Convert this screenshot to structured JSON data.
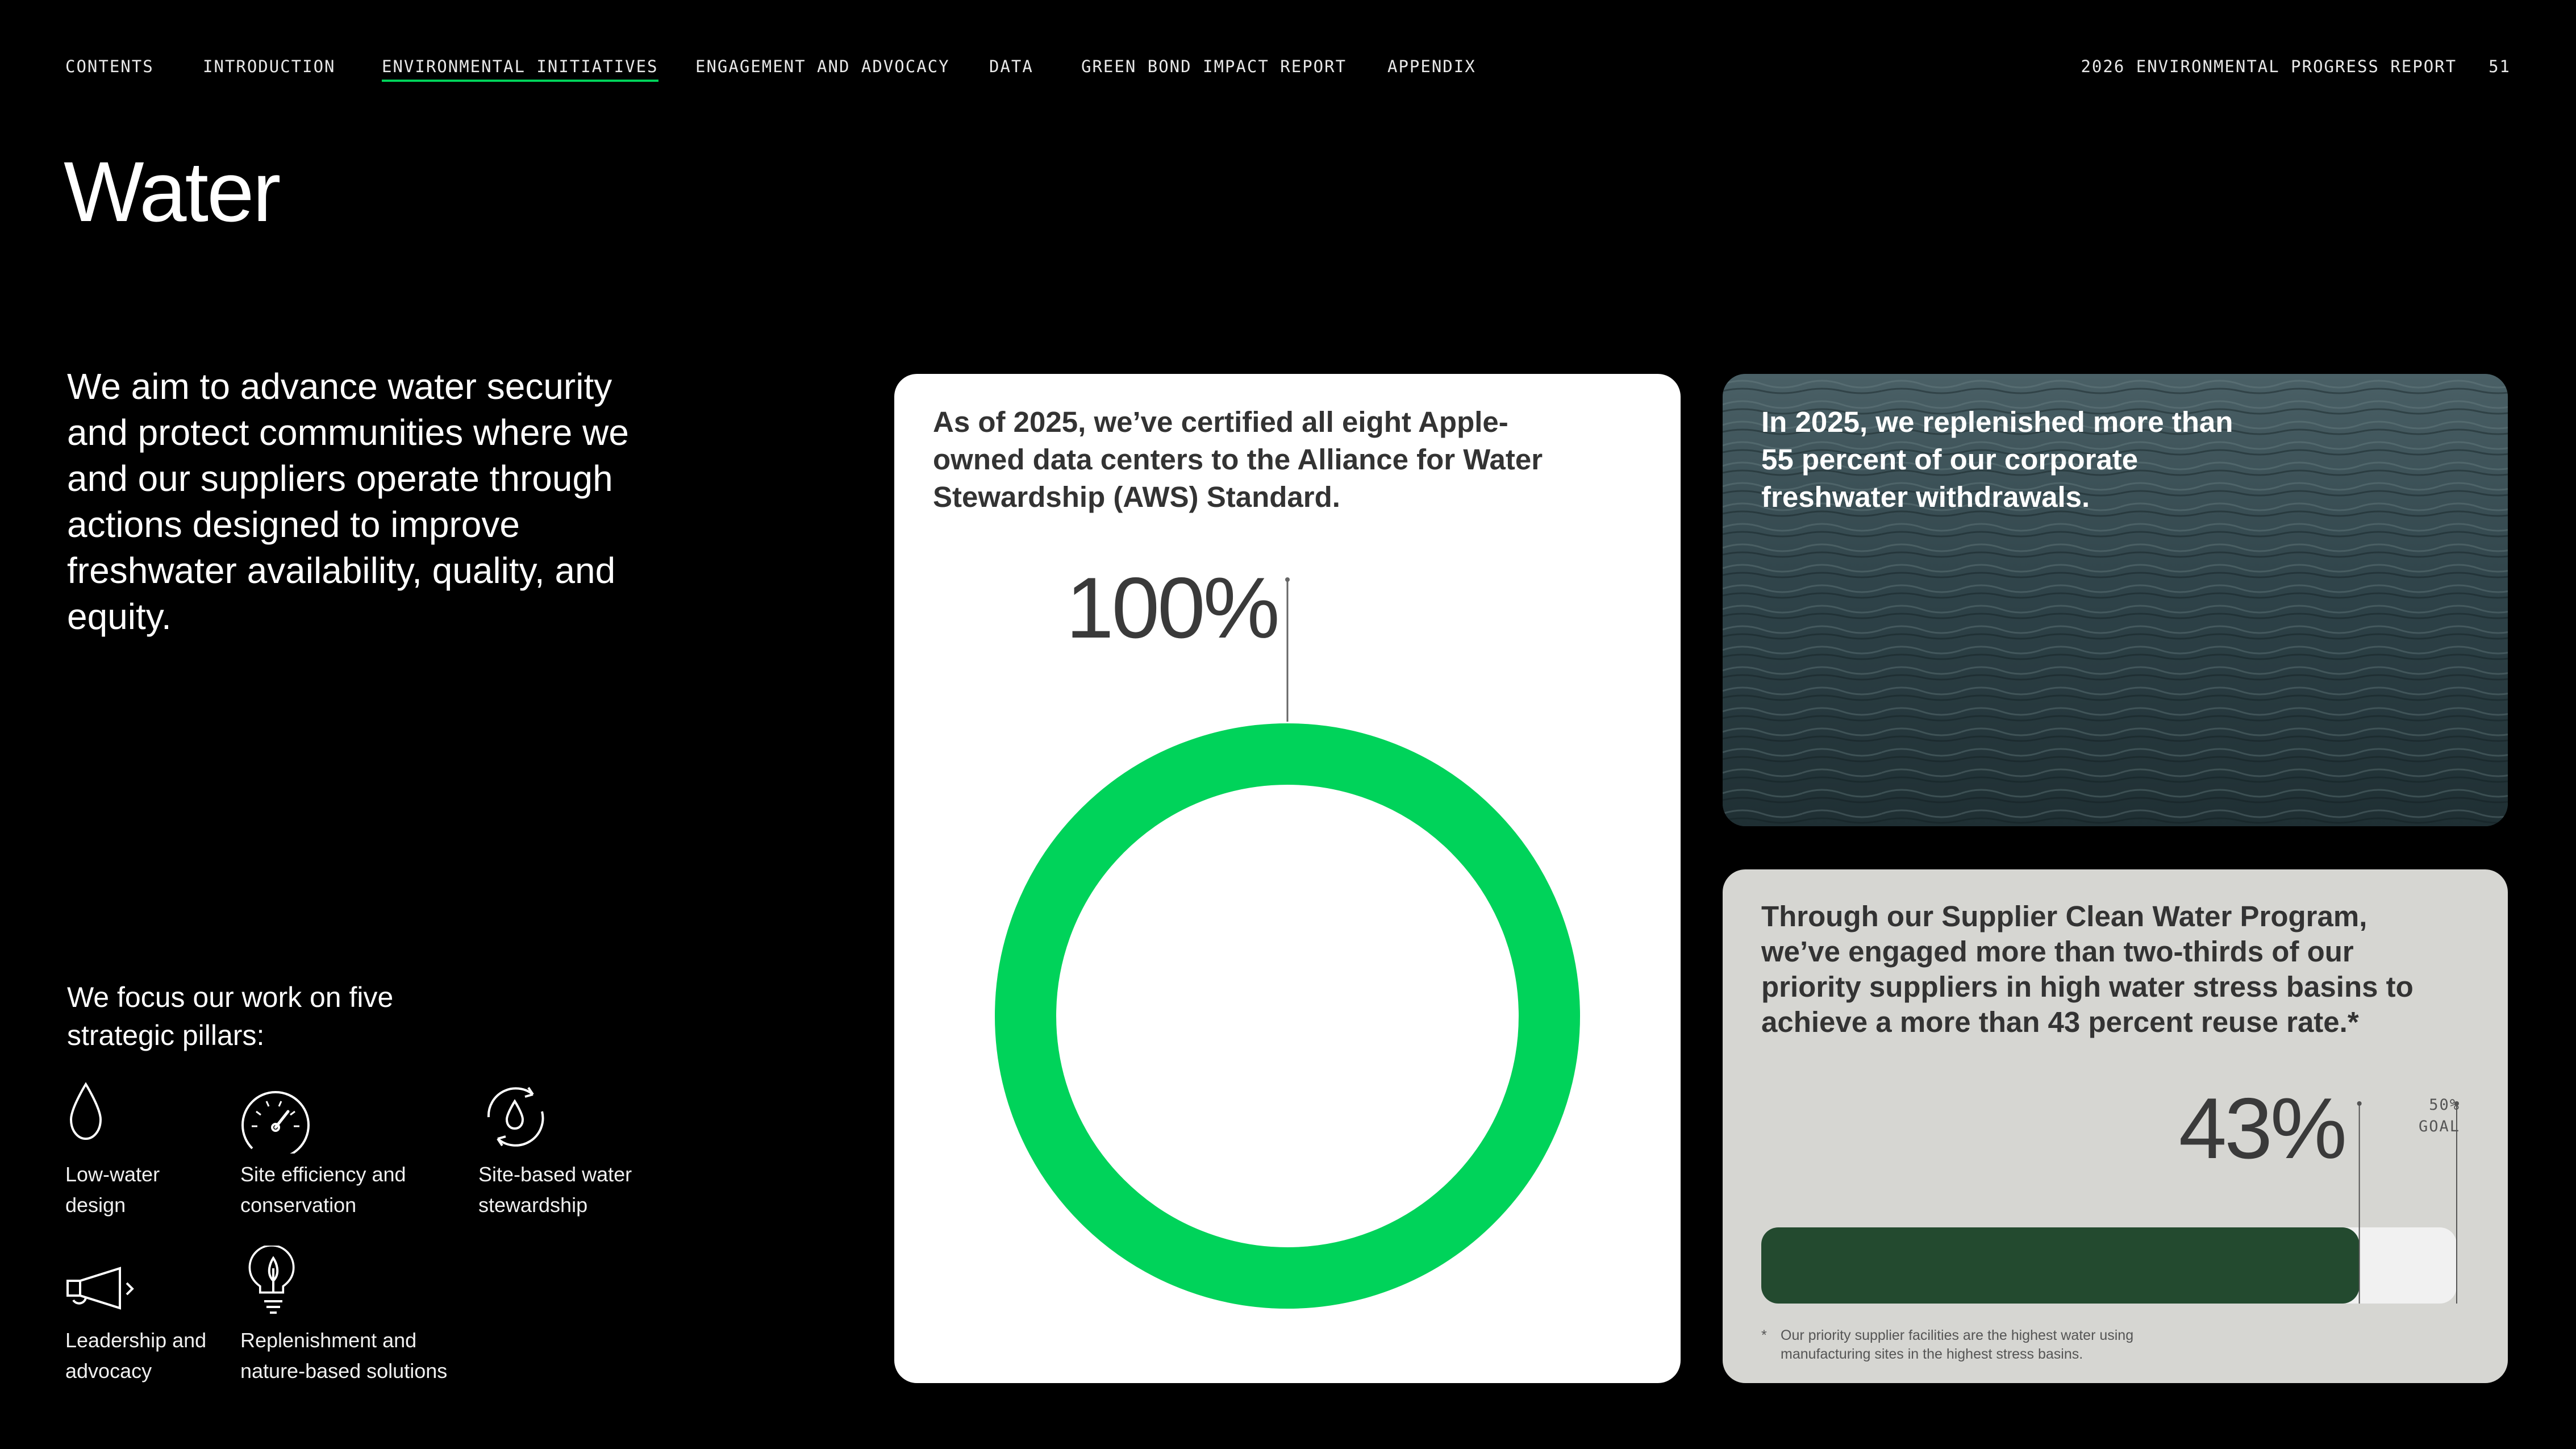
{
  "nav": {
    "items": [
      {
        "label": "CONTENTS",
        "active": false
      },
      {
        "label": "INTRODUCTION",
        "active": false
      },
      {
        "label": "ENVIRONMENTAL INITIATIVES",
        "active": true
      },
      {
        "label": "ENGAGEMENT AND ADVOCACY",
        "active": false
      },
      {
        "label": "DATA",
        "active": false
      },
      {
        "label": "GREEN BOND IMPACT REPORT",
        "active": false
      },
      {
        "label": "APPENDIX",
        "active": false
      }
    ],
    "report_title": "2026 ENVIRONMENTAL PROGRESS REPORT",
    "page_number": "51",
    "active_color": "#00d35a"
  },
  "page": {
    "title": "Water",
    "intro": "We aim to advance water security and protect communities where we and our suppliers operate through actions designed to improve freshwater availability, quality, and equity."
  },
  "pillars": {
    "heading": "We focus our work on five strategic pillars:",
    "items": [
      {
        "icon": "water-drop-icon",
        "label": "Low-water design"
      },
      {
        "icon": "gauge-icon",
        "label": "Site efficiency and conservation"
      },
      {
        "icon": "water-cycle-icon",
        "label": "Site-based water stewardship"
      },
      {
        "icon": "megaphone-icon",
        "label": "Leadership and advocacy"
      },
      {
        "icon": "lightbulb-leaf-icon",
        "label": "Replenishment and nature-based solutions"
      }
    ]
  },
  "cards": {
    "certified": {
      "text": "As of 2025, we’ve certified all eight Apple-owned data centers to the Alliance for Water Stewardship (AWS) Standard.",
      "value_label": "100%",
      "value": 1.0,
      "ring_color": "#00d35a"
    },
    "replenished": {
      "text": "In 2025, we replenished more than 55 percent of our corporate freshwater withdrawals."
    },
    "supplier": {
      "text": "Through our Supplier Clean Water Program, we’ve engaged more than two-thirds of our priority suppliers in high water stress basins to achieve a more than 43 percent reuse rate.*",
      "value_label": "43%",
      "value": 0.43,
      "goal": 0.5,
      "goal_label_1": "50%",
      "goal_label_2": "GOAL",
      "bar_color": "#234a2f",
      "footnote_star": "*",
      "footnote": "Our priority supplier facilities are the highest water using manufacturing sites in the highest stress basins."
    }
  }
}
